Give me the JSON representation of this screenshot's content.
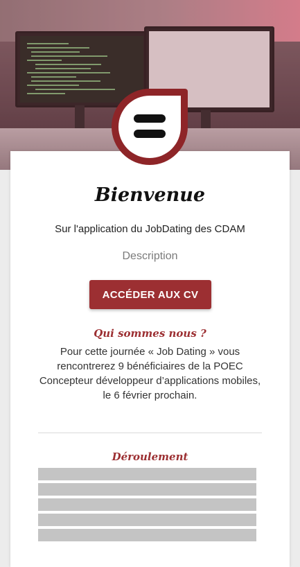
{
  "colors": {
    "accent": "#9c2f32",
    "card_bg": "#ffffff",
    "placeholder_bar": "#c4c4c4"
  },
  "hero": {
    "image": "desk-with-monitors-photo"
  },
  "logo": {
    "icon": "equals-logo-icon"
  },
  "welcome": {
    "title": "Bienvenue",
    "subtitle": "Sur l'application du JobDating des CDAM",
    "description": "Description"
  },
  "cta": {
    "label": "ACCÉDER AUX CV"
  },
  "about": {
    "title": "Qui sommes nous ?",
    "text": "Pour cette journée « Job Dating » vous rencontrerez 9 bénéficiaires de la POEC Concepteur développeur d’applications mobiles, le 6 février prochain."
  },
  "schedule": {
    "title": "Déroulement",
    "placeholder_rows": 5
  }
}
